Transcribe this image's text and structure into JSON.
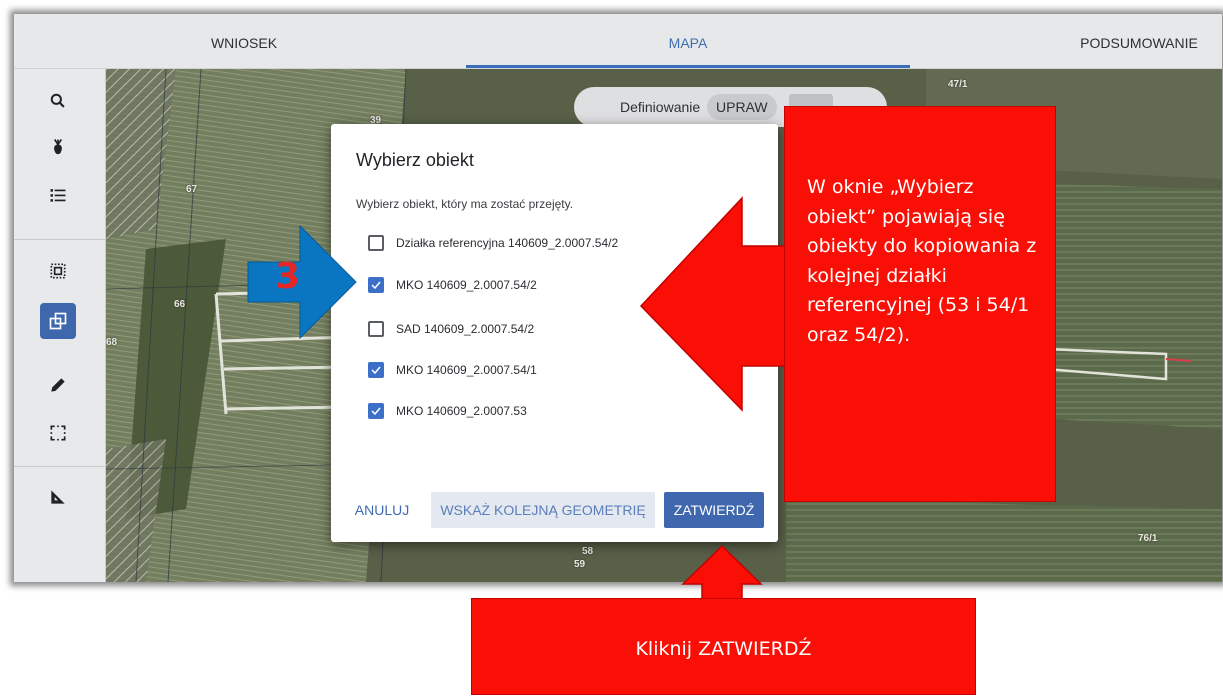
{
  "tabs": [
    {
      "label": "WNIOSEK",
      "active": false
    },
    {
      "label": "MAPA",
      "active": true
    },
    {
      "label": "PODSUMOWANIE",
      "active": false
    }
  ],
  "toolbar": {
    "items": [
      {
        "icon": "search-icon",
        "active": false
      },
      {
        "icon": "crop-icon",
        "active": false
      },
      {
        "icon": "list-icon",
        "active": false
      },
      {
        "icon": "select-area-icon",
        "active": false
      },
      {
        "icon": "copy-geometry-icon",
        "active": true
      },
      {
        "icon": "pencil-icon",
        "active": false
      },
      {
        "icon": "frame-select-icon",
        "active": false
      },
      {
        "icon": "measure-icon",
        "active": false
      }
    ]
  },
  "map": {
    "parcel_labels": [
      "39",
      "47/1",
      "67",
      "66",
      "68",
      "58",
      "59",
      "76/1"
    ],
    "define_pill": {
      "label": "Definiowanie",
      "active_chip": "UPRAW"
    }
  },
  "dialog": {
    "title": "Wybierz obiekt",
    "subtitle": "Wybierz obiekt, który ma zostać przejęty.",
    "options": [
      {
        "label": "Działka referencyjna 140609_2.0007.54/2",
        "checked": false
      },
      {
        "label": "MKO 140609_2.0007.54/2",
        "checked": true
      },
      {
        "label": "SAD 140609_2.0007.54/2",
        "checked": false
      },
      {
        "label": "MKO 140609_2.0007.54/1",
        "checked": true
      },
      {
        "label": "MKO 140609_2.0007.53",
        "checked": true
      }
    ],
    "buttons": {
      "cancel": "ANULUJ",
      "next_geometry": "WSKAŻ KOLEJNĄ GEOMETRIĘ",
      "confirm": "ZATWIERDŹ"
    }
  },
  "annotations": {
    "step_number": "3",
    "note": "W oknie „Wybierz obiekt” pojawiają się obiekty do kopiowania z kolejnej działki referencyjnej (53 i 54/1 oraz 54/2).",
    "click_hint": "Kliknij ZATWIERDŹ"
  },
  "colors": {
    "primary": "#3f67ad",
    "annotation_red": "#f90f05",
    "arrow_blue": "#0a76c2"
  }
}
